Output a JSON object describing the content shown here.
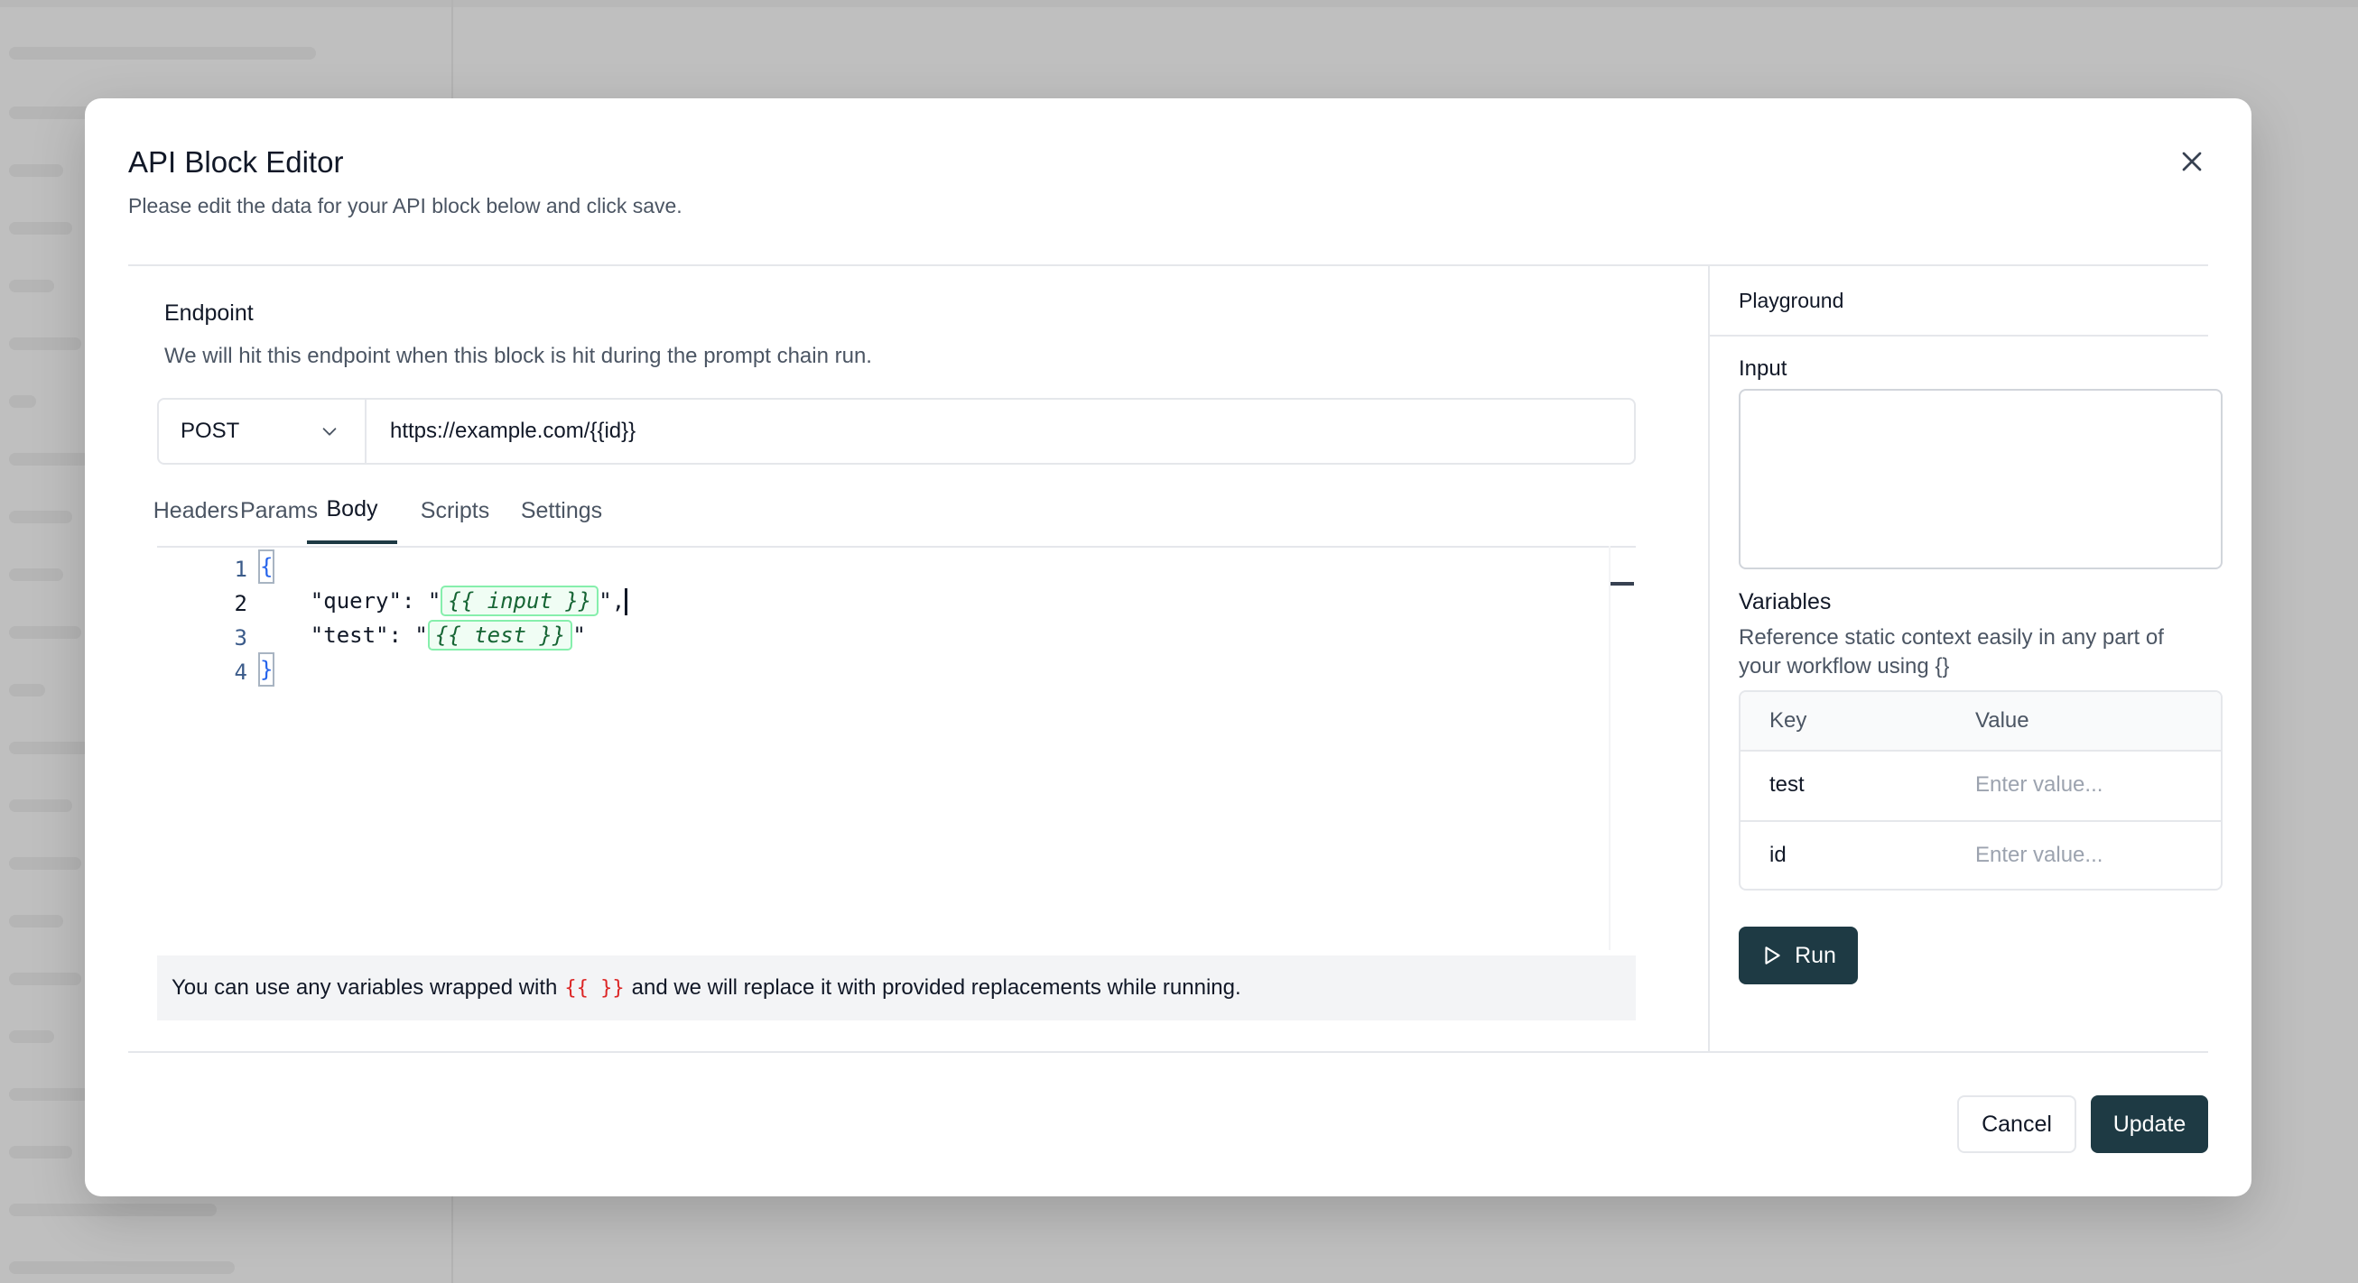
{
  "modal": {
    "title": "API Block Editor",
    "subtitle": "Please edit the data for your API block below and click save."
  },
  "endpoint": {
    "label": "Endpoint",
    "description": "We will hit this endpoint when this block is hit during the prompt chain run.",
    "method": "POST",
    "url": "https://example.com/{{id}}"
  },
  "tabs": [
    "Headers",
    "Params",
    "Body",
    "Scripts",
    "Settings"
  ],
  "active_tab": "Body",
  "editor": {
    "line_numbers": [
      "1",
      "2",
      "3",
      "4"
    ],
    "line1": "{",
    "line2_key": "    \"query\": \"",
    "line2_tpl": "{{ input }}",
    "line2_end": "\",",
    "line3_key": "    \"test\": \"",
    "line3_tpl": "{{ test }}",
    "line3_end": "\"",
    "line4": "}"
  },
  "hint": {
    "before": "You can use any variables wrapped with",
    "braces": "{{ }}",
    "after": "and we will replace it with provided replacements while running."
  },
  "playground": {
    "title": "Playground",
    "input_label": "Input",
    "input_value": "",
    "variables_label": "Variables",
    "variables_desc": "Reference static context easily in any part of your workflow using {}",
    "table_headers": [
      "Key",
      "Value"
    ],
    "rows": [
      {
        "key": "test",
        "placeholder": "Enter value..."
      },
      {
        "key": "id",
        "placeholder": "Enter value..."
      }
    ],
    "run_label": "Run"
  },
  "footer": {
    "cancel_label": "Cancel",
    "update_label": "Update"
  },
  "colors": {
    "primary": "#1e3a44",
    "template_green": "#166534",
    "hint_brace_red": "#dc2626"
  }
}
